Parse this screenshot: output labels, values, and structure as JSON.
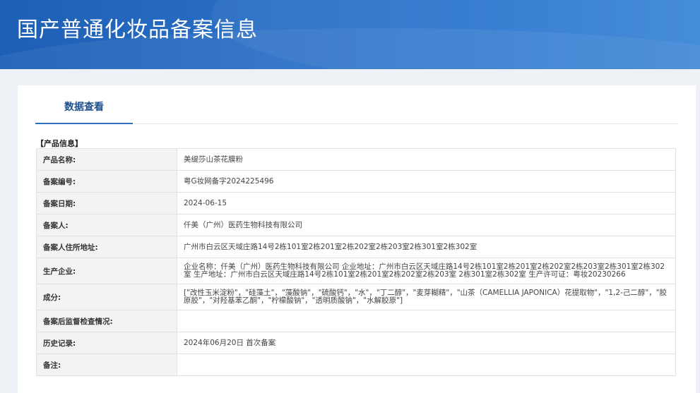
{
  "banner": {
    "title": "国产普通化妆品备案信息"
  },
  "tabs": [
    {
      "label": "数据查看"
    }
  ],
  "section": {
    "label": "【产品信息】"
  },
  "rows": [
    {
      "key": "产品名称:",
      "value": "美缇莎山茶花膜粉"
    },
    {
      "key": "备案编号:",
      "value": "粤G妆网备字2024225496"
    },
    {
      "key": "备案日期:",
      "value": "2024-06-15"
    },
    {
      "key": "备案人:",
      "value": "仟美（广州）医药生物科技有限公司"
    },
    {
      "key": "备案人住所地址:",
      "value": "广州市白云区天域庄路14号2栋101室2栋201室2栋202室2栋203室2栋301室2栋302室"
    },
    {
      "key": "生产企业:",
      "value": "企业名称：仟美（广州）医药生物科技有限公司 企业地址：广州市白云区天域庄路14号2栋101室2栋201室2栋202室2栋203室2栋301室2栋302室 生产地址：广州市白云区天域庄路14号2栋101室2栋201室2栋202室2栋203室 2栋301室2栋302室 生产许可证：粤妆20230266"
    },
    {
      "key": "成分:",
      "value": "[\"改性玉米淀粉\"，\"硅藻土\"，\"藻酸钠\"，\"硫酸钙\"，\"水\"，\"丁二醇\"，\"麦芽糊精\"，\"山茶（CAMELLIA JAPONICA）花提取物\"，\"1,2-己二醇\"，\"胶原胶\"，\"对羟基苯乙酮\"，\"柠檬酸钠\"，\"透明质酸钠\"，\"水解胶原\"]"
    },
    {
      "key": "备案后监督检查情况:",
      "value": ""
    },
    {
      "key": "历史记录:",
      "value": "2024年06月20日 首次备案"
    },
    {
      "key": "备注:",
      "value": ""
    }
  ]
}
